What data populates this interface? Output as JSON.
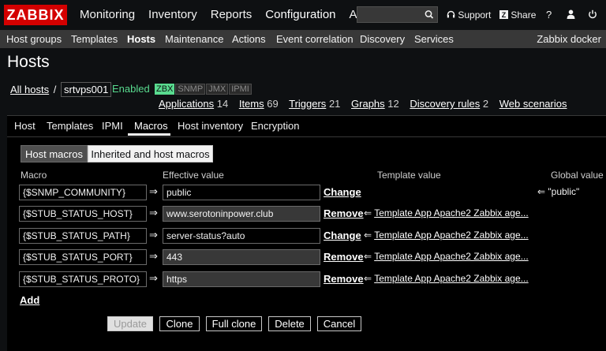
{
  "header": {
    "logo": "ZABBIX",
    "menu": [
      "Monitoring",
      "Inventory",
      "Reports",
      "Configuration",
      "Admi"
    ],
    "search_value": "",
    "support": "Support",
    "share": "Share",
    "help": "?"
  },
  "subnav": {
    "items": [
      "Host groups",
      "Templates",
      "Hosts",
      "Maintenance",
      "Actions",
      "Event correlation",
      "Discovery",
      "Services"
    ],
    "server_name": "Zabbix docker"
  },
  "page_title": "Hosts",
  "breadcrumb": {
    "all_hosts": "All hosts",
    "separator": "/",
    "host": "srtvps001",
    "status": "Enabled",
    "availability": [
      "ZBX",
      "SNMP",
      "JMX",
      "IPMI"
    ]
  },
  "host_links": [
    {
      "label": "Applications",
      "count": "14"
    },
    {
      "label": "Items",
      "count": "69"
    },
    {
      "label": "Triggers",
      "count": "21"
    },
    {
      "label": "Graphs",
      "count": "12"
    },
    {
      "label": "Discovery rules",
      "count": "2"
    },
    {
      "label": "Web scenarios",
      "count": ""
    }
  ],
  "tabs": [
    "Host",
    "Templates",
    "IPMI",
    "Macros",
    "Host inventory",
    "Encryption"
  ],
  "macro_modes": [
    "Host macros",
    "Inherited and host macros"
  ],
  "columns": [
    "Macro",
    "Effective value",
    "Template value",
    "Global value"
  ],
  "macros": [
    {
      "macro": "{$SNMP_COMMUNITY}",
      "arrow": "⇒",
      "value": "public",
      "action": "Change",
      "template": "",
      "global": "⇐ \"public\""
    },
    {
      "macro": "{$STUB_STATUS_HOST}",
      "arrow": "⇒",
      "value": "www.serotoninpower.club",
      "action": "Remove",
      "template_arrow": "⇐",
      "template": "Template App Apache2 Zabbix age...",
      "global": ""
    },
    {
      "macro": "{$STUB_STATUS_PATH}",
      "arrow": "⇒",
      "value": "server-status?auto",
      "action": "Change",
      "template_arrow": "⇐",
      "template": "Template App Apache2 Zabbix age...",
      "global": ""
    },
    {
      "macro": "{$STUB_STATUS_PORT}",
      "arrow": "⇒",
      "value": "443",
      "action": "Remove",
      "template_arrow": "⇐",
      "template": "Template App Apache2 Zabbix age...",
      "global": ""
    },
    {
      "macro": "{$STUB_STATUS_PROTO}",
      "arrow": "⇒",
      "value": "https",
      "action": "Remove",
      "template_arrow": "⇐",
      "template": "Template App Apache2 Zabbix age...",
      "global": ""
    }
  ],
  "add_label": "Add",
  "buttons": [
    "Update",
    "Clone",
    "Full clone",
    "Delete",
    "Cancel"
  ]
}
